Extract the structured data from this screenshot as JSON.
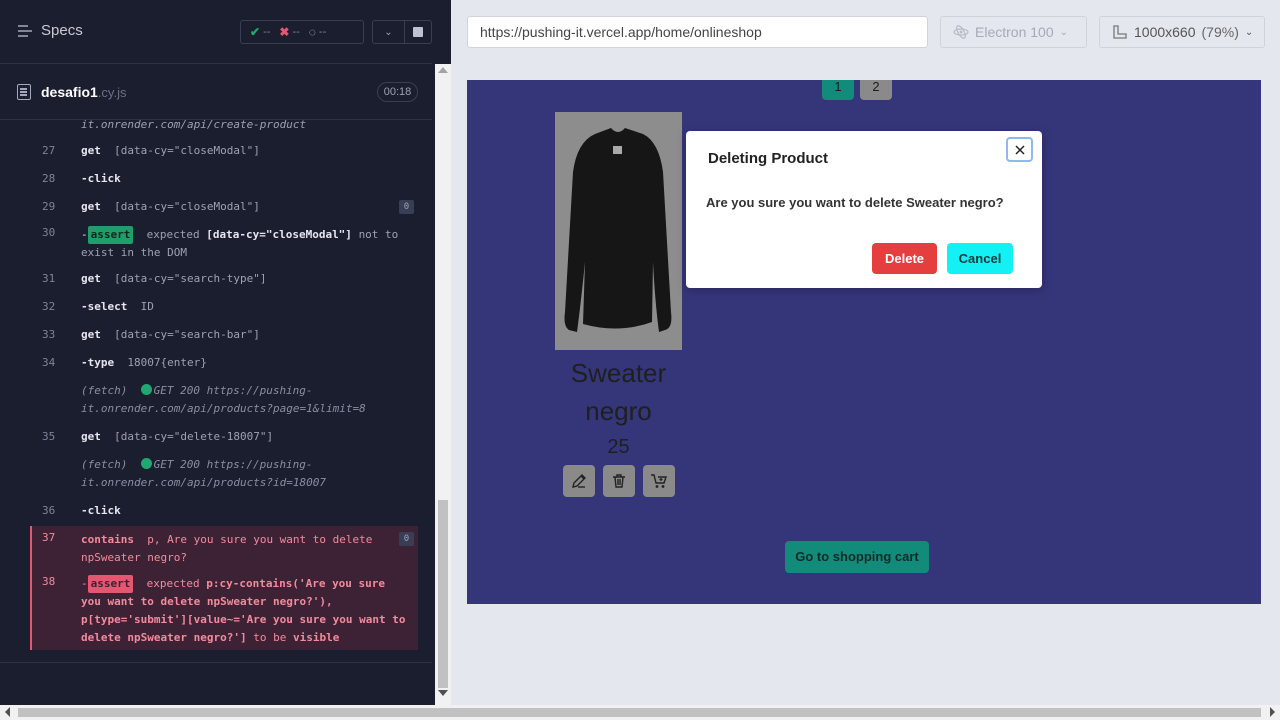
{
  "reporter": {
    "specs_label": "Specs",
    "stats": {
      "passed": "--",
      "failed": "--",
      "pending": "--"
    },
    "file": {
      "name": "desafio1",
      "ext": ".cy.js",
      "timer": "00:18"
    },
    "log": {
      "top_cut": "it.onrender.com/api/create-product",
      "rows": [
        {
          "n": "27",
          "cmd": "get",
          "arg": "[data-cy=\"closeModal\"]"
        },
        {
          "n": "28",
          "cmd": "-click",
          "arg": ""
        },
        {
          "n": "29",
          "cmd": "get",
          "arg": "[data-cy=\"closeModal\"]",
          "badge": "0"
        },
        {
          "n": "30",
          "assert_tag": "assert",
          "text_a": "expected",
          "text_b": "[data-cy=\"closeModal\"]",
          "text_c": "not to",
          "text_d": "exist in the DOM"
        },
        {
          "n": "31",
          "cmd": "get",
          "arg": "[data-cy=\"search-type\"]"
        },
        {
          "n": "32",
          "cmd": "-select",
          "arg": "ID"
        },
        {
          "n": "33",
          "cmd": "get",
          "arg": "[data-cy=\"search-bar\"]"
        },
        {
          "n": "34",
          "cmd": "-type",
          "arg": "18007{enter}"
        },
        {
          "fetch": "(fetch)",
          "line1": "GET 200 https://pushing-",
          "line2": "it.onrender.com/api/products?page=1&limit=8"
        },
        {
          "n": "35",
          "cmd": "get",
          "arg": "[data-cy=\"delete-18007\"]"
        },
        {
          "fetch": "(fetch)",
          "line1": "GET 200 https://pushing-",
          "line2": "it.onrender.com/api/products?id=18007"
        },
        {
          "n": "36",
          "cmd": "-click",
          "arg": ""
        },
        {
          "n": "37",
          "cmd": "contains",
          "arg": "p, Are you sure you want to delete",
          "arg2": "npSweater negro?",
          "badge": "0"
        },
        {
          "n": "38",
          "assert_tag": "assert",
          "text_a": "expected",
          "text_b": "p:cy-contains('Are you sure",
          "line2": "you want to delete npSweater negro?'),",
          "line3": "p[type='submit'][value~='Are you sure you want to",
          "line4_a": "delete npSweater negro?']",
          "line4_b": "to be",
          "line4_c": "visible"
        }
      ]
    }
  },
  "browser": {
    "url": "https://pushing-it.vercel.app/home/onlineshop",
    "engine": "Electron 100",
    "viewport": "1000x660",
    "zoom": "(79%)"
  },
  "app": {
    "pages": [
      "1",
      "2"
    ],
    "product": {
      "name": "Sweater negro",
      "price": "25"
    },
    "go_cart": "Go to shopping cart",
    "modal": {
      "title": "Deleting Product",
      "text": "Are you sure you want to delete Sweater negro?",
      "delete": "Delete",
      "cancel": "Cancel"
    }
  },
  "colors": {
    "app_bg": "#35357a",
    "delete": "#e53e3e",
    "cancel": "#14f1f5",
    "cart": "#128b7a",
    "error": "#e45770",
    "pass": "#1f9e6c"
  }
}
